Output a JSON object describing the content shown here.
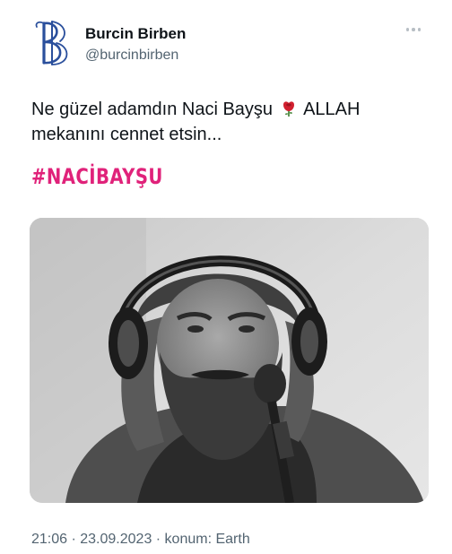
{
  "tweet": {
    "author_name": "Burcin Birben",
    "author_handle": "@burcinbirben",
    "text_line1_before": "Ne güzel adamdın Naci Bayşu",
    "text_line1_after": "ALLAH",
    "text_line2": "mekanını cennet etsin...",
    "emoji_icon": "rose-icon",
    "hashtag": "#NACİBAYŞU",
    "timestamp": "21:06 · 23.09.2023 · konum: Earth",
    "avatar_icon": "monogram-bb-logo",
    "more_icon": "more-horizontal-icon",
    "photo": "black-and-white portrait of bearded man with headphones and microphone"
  },
  "colors": {
    "hashtag": "#e0227a",
    "handle_gray": "#536471",
    "logo_blue": "#2a4f9c"
  }
}
